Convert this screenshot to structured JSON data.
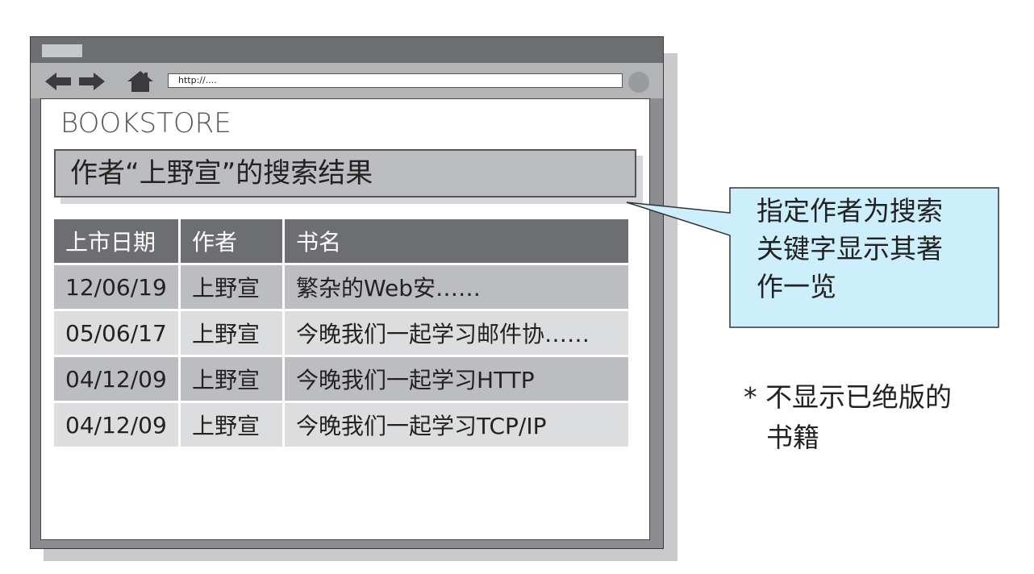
{
  "browser": {
    "address": "http://...."
  },
  "page": {
    "brand": "BOOKSTORE",
    "result_title": "作者“上野宣”的搜索结果"
  },
  "table": {
    "headers": [
      "上市日期",
      "作者",
      "书名"
    ],
    "rows": [
      [
        "12/06/19",
        "上野宣",
        "繁杂的Web安……"
      ],
      [
        "05/06/17",
        "上野宣",
        "今晚我们一起学习邮件协……"
      ],
      [
        "04/12/09",
        "上野宣",
        "今晚我们一起学习HTTP"
      ],
      [
        "04/12/09",
        "上野宣",
        "今晚我们一起学习TCP/IP"
      ]
    ]
  },
  "callout": {
    "lines": [
      "指定作者为搜索",
      "关键字显示其著",
      "作一览"
    ]
  },
  "note": {
    "lines": [
      "* 不显示已绝版的",
      "书籍"
    ]
  },
  "colors": {
    "callout_fill": "#cdeefb",
    "header_fill": "#6d6e71",
    "row_dark": "#bcbdc0",
    "row_light": "#dcdddf"
  }
}
